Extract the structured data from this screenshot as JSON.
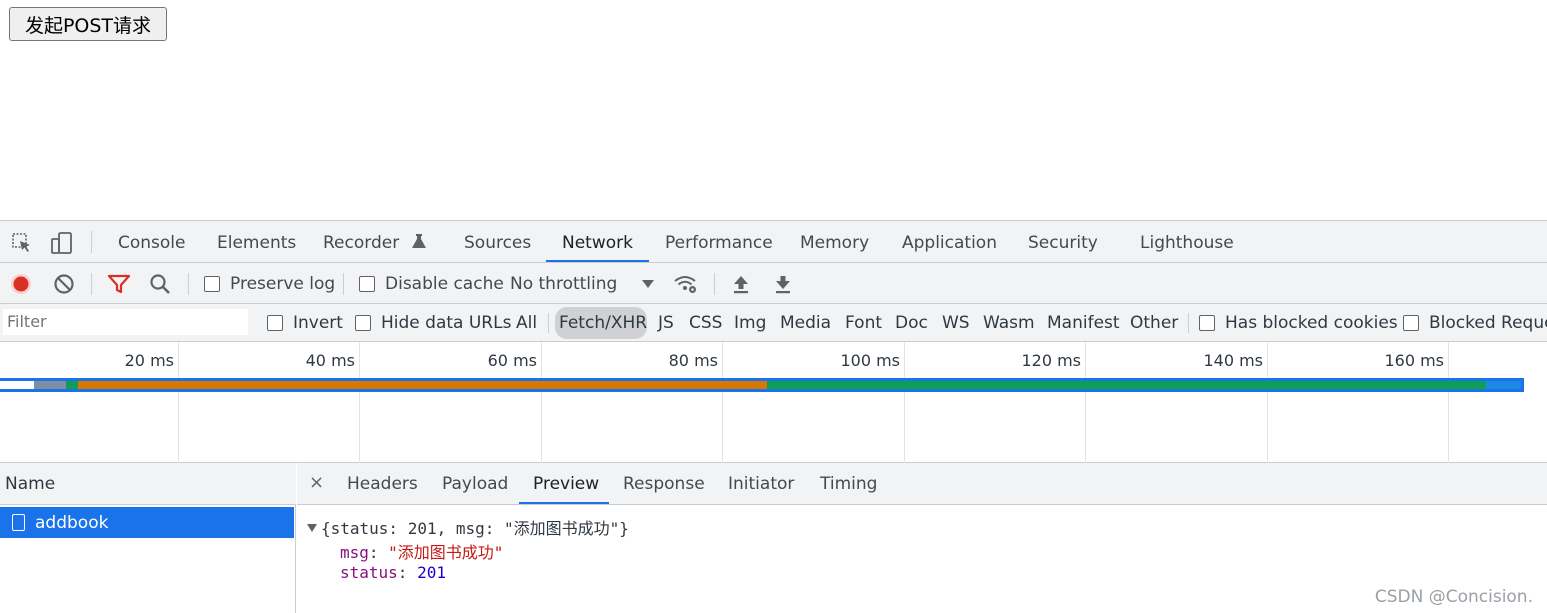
{
  "page": {
    "button_label": "发起POST请求"
  },
  "devtools": {
    "tabs": [
      "Console",
      "Elements",
      "Recorder",
      "Sources",
      "Network",
      "Performance",
      "Memory",
      "Application",
      "Security",
      "Lighthouse"
    ],
    "active_tab": "Network",
    "network_toolbar": {
      "preserve_log": "Preserve log",
      "disable_cache": "Disable cache",
      "throttling": "No throttling",
      "preserve_log_checked": false,
      "disable_cache_checked": false
    },
    "filter_bar": {
      "placeholder": "Filter",
      "invert": "Invert",
      "hide_data_urls": "Hide data URLs",
      "types": [
        "All",
        "Fetch/XHR",
        "JS",
        "CSS",
        "Img",
        "Media",
        "Font",
        "Doc",
        "WS",
        "Wasm",
        "Manifest",
        "Other"
      ],
      "active_type": "Fetch/XHR",
      "has_blocked_cookies": "Has blocked cookies",
      "blocked_requests": "Blocked Reque"
    },
    "timeline": {
      "ticks": [
        "20 ms",
        "40 ms",
        "60 ms",
        "80 ms",
        "100 ms",
        "120 ms",
        "140 ms",
        "160 ms"
      ],
      "colors": {
        "frame": "#1a73e8",
        "queue": "#ffffff",
        "stalled": "#7f8ea3",
        "waiting": "#d97706",
        "download": "#0f9d58",
        "tail": "#1e88e5"
      }
    },
    "requests": {
      "column_header": "Name",
      "items": [
        {
          "name": "addbook",
          "selected": true
        }
      ]
    },
    "detail": {
      "close": "×",
      "tabs": [
        "Headers",
        "Payload",
        "Preview",
        "Response",
        "Initiator",
        "Timing"
      ],
      "active_tab": "Preview",
      "preview": {
        "summary": "{status: 201, msg: \"添加图书成功\"}",
        "msg_key": "msg",
        "msg_value": "\"添加图书成功\"",
        "status_key": "status",
        "status_value": "201"
      }
    }
  },
  "watermark": "CSDN @Concision."
}
